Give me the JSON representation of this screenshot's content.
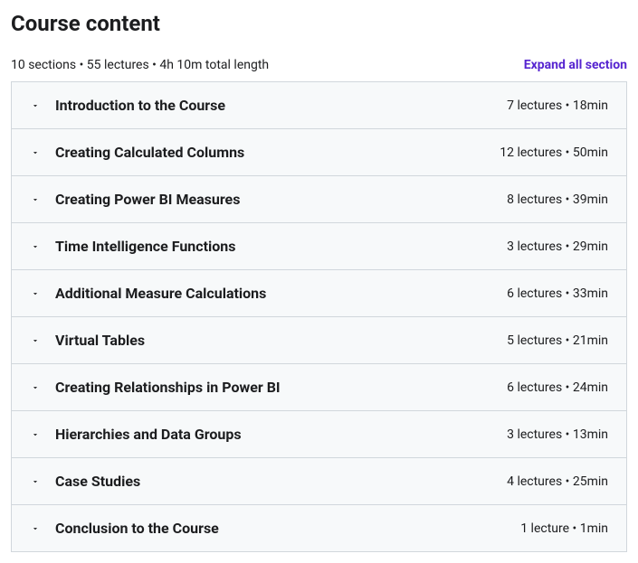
{
  "heading": "Course content",
  "summary": "10 sections • 55 lectures • 4h 10m total length",
  "expand_label": "Expand all section",
  "sections": [
    {
      "title": "Introduction to the Course",
      "meta": "7 lectures • 18min"
    },
    {
      "title": "Creating Calculated Columns",
      "meta": "12 lectures • 50min"
    },
    {
      "title": "Creating Power BI Measures",
      "meta": "8 lectures • 39min"
    },
    {
      "title": "Time Intelligence Functions",
      "meta": "3 lectures • 29min"
    },
    {
      "title": "Additional Measure Calculations",
      "meta": "6 lectures • 33min"
    },
    {
      "title": "Virtual Tables",
      "meta": "5 lectures • 21min"
    },
    {
      "title": "Creating Relationships in Power BI",
      "meta": "6 lectures • 24min"
    },
    {
      "title": "Hierarchies and Data Groups",
      "meta": "3 lectures • 13min"
    },
    {
      "title": "Case Studies",
      "meta": "4 lectures • 25min"
    },
    {
      "title": "Conclusion to the Course",
      "meta": "1 lecture • 1min"
    }
  ]
}
